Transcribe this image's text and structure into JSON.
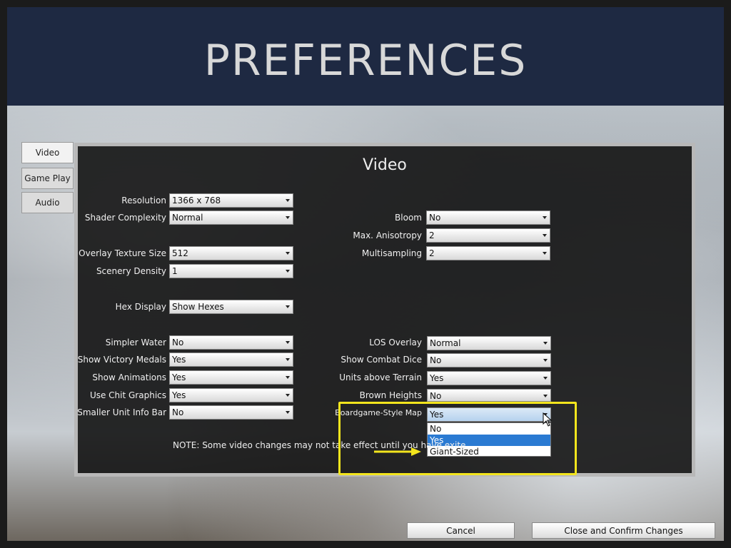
{
  "header": {
    "title": "PREFERENCES"
  },
  "tabs": [
    {
      "label": "Video",
      "active": true
    },
    {
      "label": "Game Play",
      "active": false
    },
    {
      "label": "Audio",
      "active": false
    }
  ],
  "panel": {
    "title": "Video",
    "left_settings": [
      {
        "label": "Resolution",
        "value": "1366 x 768"
      },
      {
        "label": "Shader Complexity",
        "value": "Normal"
      },
      {
        "label": "Overlay Texture Size",
        "value": "512"
      },
      {
        "label": "Scenery Density",
        "value": "1"
      },
      {
        "label": "Hex Display",
        "value": "Show Hexes"
      },
      {
        "label": "Simpler Water",
        "value": "No"
      },
      {
        "label": "Show Victory Medals",
        "value": "Yes"
      },
      {
        "label": "Show Animations",
        "value": "Yes"
      },
      {
        "label": "Use Chit Graphics",
        "value": "Yes"
      },
      {
        "label": "Smaller Unit Info Bar",
        "value": "No"
      }
    ],
    "right_settings": [
      {
        "label": "Bloom",
        "value": "No"
      },
      {
        "label": "Max. Anisotropy",
        "value": "2"
      },
      {
        "label": "Multisampling",
        "value": "2"
      },
      {
        "label": "LOS Overlay",
        "value": "Normal"
      },
      {
        "label": "Show Combat Dice",
        "value": "No"
      },
      {
        "label": "Units above Terrain",
        "value": "Yes"
      },
      {
        "label": "Brown Heights",
        "value": "No"
      },
      {
        "label": "Boardgame-Style Map",
        "value": "Yes"
      }
    ],
    "open_dropdown": {
      "options": [
        "No",
        "Yes",
        "Giant-Sized"
      ],
      "selected": "Yes"
    },
    "note": "NOTE: Some video changes may not take effect until you have exite"
  },
  "footer": {
    "cancel_label": "Cancel",
    "confirm_label": "Close and Confirm Changes"
  },
  "colors": {
    "header_bg": "#1e2942",
    "highlight": "#f3e51d",
    "selection": "#2a7ad2"
  }
}
